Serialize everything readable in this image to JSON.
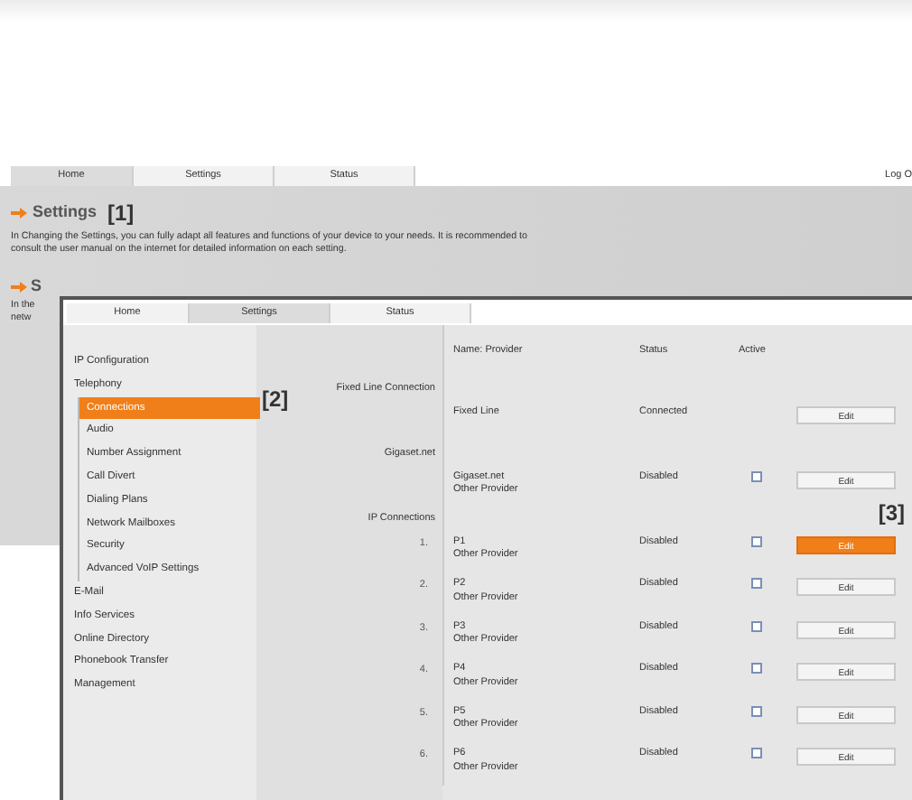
{
  "back_window": {
    "tabs": [
      {
        "label": "Home",
        "selected": true
      },
      {
        "label": "Settings",
        "selected": false
      },
      {
        "label": "Status",
        "selected": false
      }
    ],
    "logout": "Log O",
    "heading": "Settings",
    "callout": "[1]",
    "intro": "In Changing the Settings, you can fully adapt all features and functions of your device to your needs. It is recommended to consult the user manual on the internet for detailed information on each setting.",
    "second_heading": "S",
    "second_lines": [
      "In the",
      "netw"
    ]
  },
  "front_window": {
    "tabs": [
      {
        "label": "Home",
        "selected": false
      },
      {
        "label": "Settings",
        "selected": true
      },
      {
        "label": "Status",
        "selected": false
      }
    ],
    "sidebar": [
      {
        "label": "IP Configuration",
        "selected": false
      },
      {
        "label": "Telephony",
        "selected": false,
        "children": [
          {
            "label": "Connections",
            "selected": true
          },
          {
            "label": "Audio",
            "selected": false
          },
          {
            "label": "Number Assignment",
            "selected": false
          },
          {
            "label": "Call Divert",
            "selected": false
          },
          {
            "label": "Dialing Plans",
            "selected": false
          },
          {
            "label": "Network Mailboxes",
            "selected": false
          },
          {
            "label": "Security",
            "selected": false
          },
          {
            "label": "Advanced VoIP Settings",
            "selected": false
          }
        ]
      },
      {
        "label": "E-Mail",
        "selected": false
      },
      {
        "label": "Info Services",
        "selected": false
      },
      {
        "label": "Online Directory",
        "selected": false
      },
      {
        "label": "Phonebook Transfer",
        "selected": false
      },
      {
        "label": "Management",
        "selected": false
      }
    ],
    "sidebar_callout": "[2]",
    "table_callout": "[3]",
    "columns": [
      "Name: Provider",
      "Status",
      "Active"
    ],
    "rows": [
      {
        "kind": "section",
        "label": "Fixed Line Connection"
      },
      {
        "kind": "connection",
        "name": "Fixed Line",
        "status": "Connected",
        "edit": "Edit",
        "highlighted": false
      },
      {
        "kind": "section",
        "label": "Gigaset.net"
      },
      {
        "kind": "connection",
        "name": "Gigaset.net",
        "provider": "Other Provider",
        "status": "Disabled",
        "checked": false,
        "edit": "Edit",
        "highlighted": false
      },
      {
        "kind": "section",
        "label": "IP Connections"
      },
      {
        "kind": "connection",
        "number": "1.",
        "name": "P1",
        "provider": "Other Provider",
        "status": "Disabled",
        "checked": false,
        "edit": "Edit",
        "highlighted": true
      },
      {
        "kind": "connection",
        "number": "2.",
        "name": "P2",
        "provider": "Other Provider",
        "status": "Disabled",
        "checked": false,
        "edit": "Edit",
        "highlighted": false
      },
      {
        "kind": "connection",
        "number": "3.",
        "name": "P3",
        "provider": "Other Provider",
        "status": "Disabled",
        "checked": false,
        "edit": "Edit",
        "highlighted": false
      },
      {
        "kind": "connection",
        "number": "4.",
        "name": "P4",
        "provider": "Other Provider",
        "status": "Disabled",
        "checked": false,
        "edit": "Edit",
        "highlighted": false
      },
      {
        "kind": "connection",
        "number": "5.",
        "name": "P5",
        "provider": "Other Provider",
        "status": "Disabled",
        "checked": false,
        "edit": "Edit",
        "highlighted": false
      },
      {
        "kind": "connection",
        "number": "6.",
        "name": "P6",
        "provider": "Other Provider",
        "status": "Disabled",
        "checked": false,
        "edit": "Edit",
        "highlighted": false
      }
    ]
  }
}
